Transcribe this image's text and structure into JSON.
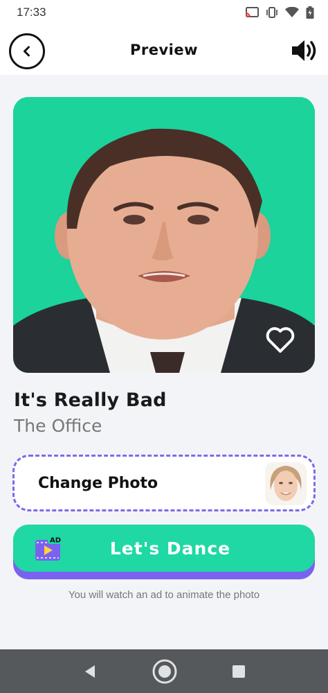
{
  "status_bar": {
    "time": "17:33",
    "icons": [
      "cast-icon",
      "vibrate-icon",
      "wifi-icon",
      "battery-icon"
    ]
  },
  "header": {
    "title": "Preview",
    "back_icon": "back-arrow-icon",
    "sound_icon": "speaker-icon"
  },
  "preview": {
    "favorite_icon": "heart-outline-icon",
    "background_color": "#1bd39b"
  },
  "song": {
    "title": "It's Really Bad",
    "subtitle": "The Office"
  },
  "change_photo": {
    "label": "Change Photo"
  },
  "dance_button": {
    "label": "Let's Dance",
    "badge": "AD",
    "icon": "ad-video-icon"
  },
  "ad_note": "You will watch an ad to animate the photo",
  "colors": {
    "accent_green": "#1fd8a4",
    "accent_purple": "#7b61f0",
    "dashed_border": "#7b6be8"
  },
  "nav": [
    "nav-back-icon",
    "nav-home-icon",
    "nav-recents-icon"
  ]
}
